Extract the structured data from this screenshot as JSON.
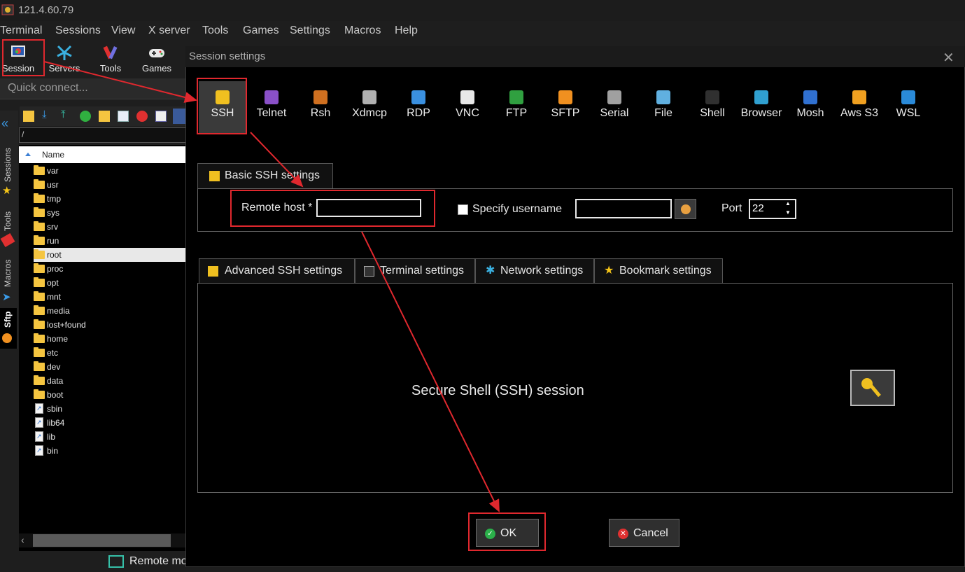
{
  "window": {
    "title": "121.4.60.79"
  },
  "menu": [
    "Terminal",
    "Sessions",
    "View",
    "X server",
    "Tools",
    "Games",
    "Settings",
    "Macros",
    "Help"
  ],
  "toolbar": [
    {
      "label": "Session",
      "icon": "session-icon"
    },
    {
      "label": "Servers",
      "icon": "servers-icon"
    },
    {
      "label": "Tools",
      "icon": "tools-icon"
    },
    {
      "label": "Games",
      "icon": "gamepad-icon"
    }
  ],
  "quick_connect": {
    "placeholder": "Quick connect..."
  },
  "side_tabs": [
    "Sessions",
    "Tools",
    "Macros",
    "Sftp"
  ],
  "sftp": {
    "path": "/",
    "column_name": "Name",
    "files": [
      {
        "name": "var",
        "type": "folder"
      },
      {
        "name": "usr",
        "type": "folder"
      },
      {
        "name": "tmp",
        "type": "folder"
      },
      {
        "name": "sys",
        "type": "folder"
      },
      {
        "name": "srv",
        "type": "folder"
      },
      {
        "name": "run",
        "type": "folder"
      },
      {
        "name": "root",
        "type": "folder",
        "selected": true
      },
      {
        "name": "proc",
        "type": "folder"
      },
      {
        "name": "opt",
        "type": "folder"
      },
      {
        "name": "mnt",
        "type": "folder"
      },
      {
        "name": "media",
        "type": "folder"
      },
      {
        "name": "lost+found",
        "type": "folder"
      },
      {
        "name": "home",
        "type": "folder"
      },
      {
        "name": "etc",
        "type": "folder"
      },
      {
        "name": "dev",
        "type": "folder"
      },
      {
        "name": "data",
        "type": "folder"
      },
      {
        "name": "boot",
        "type": "folder"
      },
      {
        "name": "sbin",
        "type": "link"
      },
      {
        "name": "lib64",
        "type": "link"
      },
      {
        "name": "lib",
        "type": "link"
      },
      {
        "name": "bin",
        "type": "link"
      }
    ]
  },
  "status_bar": {
    "text": "Remote mo"
  },
  "dialog": {
    "title": "Session settings",
    "session_types": [
      {
        "label": "SSH",
        "icon": "key-icon",
        "color": "#f0c020",
        "selected": true
      },
      {
        "label": "Telnet",
        "icon": "telnet-icon",
        "color": "#8a50c8"
      },
      {
        "label": "Rsh",
        "icon": "rsh-icon",
        "color": "#d07020"
      },
      {
        "label": "Xdmcp",
        "icon": "xdmcp-icon",
        "color": "#b0b0b0"
      },
      {
        "label": "RDP",
        "icon": "rdp-icon",
        "color": "#3a90e0"
      },
      {
        "label": "VNC",
        "icon": "vnc-icon",
        "color": "#e8e8e8"
      },
      {
        "label": "FTP",
        "icon": "ftp-icon",
        "color": "#30a040"
      },
      {
        "label": "SFTP",
        "icon": "sftp-icon",
        "color": "#f09020"
      },
      {
        "label": "Serial",
        "icon": "serial-icon",
        "color": "#a0a0a0"
      },
      {
        "label": "File",
        "icon": "file-icon",
        "color": "#60b0e0"
      },
      {
        "label": "Shell",
        "icon": "shell-icon",
        "color": "#303030"
      },
      {
        "label": "Browser",
        "icon": "browser-icon",
        "color": "#30a0d0"
      },
      {
        "label": "Mosh",
        "icon": "mosh-icon",
        "color": "#3070d0"
      },
      {
        "label": "Aws S3",
        "icon": "aws-icon",
        "color": "#f0a020"
      },
      {
        "label": "WSL",
        "icon": "wsl-icon",
        "color": "#2a8ad8"
      }
    ],
    "basic_tab": "Basic SSH settings",
    "remote_host_label": "Remote host *",
    "remote_host_value": "",
    "specify_username_label": "Specify username",
    "username_value": "",
    "port_label": "Port",
    "port_value": "22",
    "adv_tabs": [
      "Advanced SSH settings",
      "Terminal settings",
      "Network settings",
      "Bookmark settings"
    ],
    "description": "Secure Shell (SSH) session",
    "ok_label": "OK",
    "cancel_label": "Cancel"
  },
  "colors": {
    "highlight": "#e0282e",
    "accent_green": "#2bb04a",
    "cancel_red": "#e03030"
  }
}
